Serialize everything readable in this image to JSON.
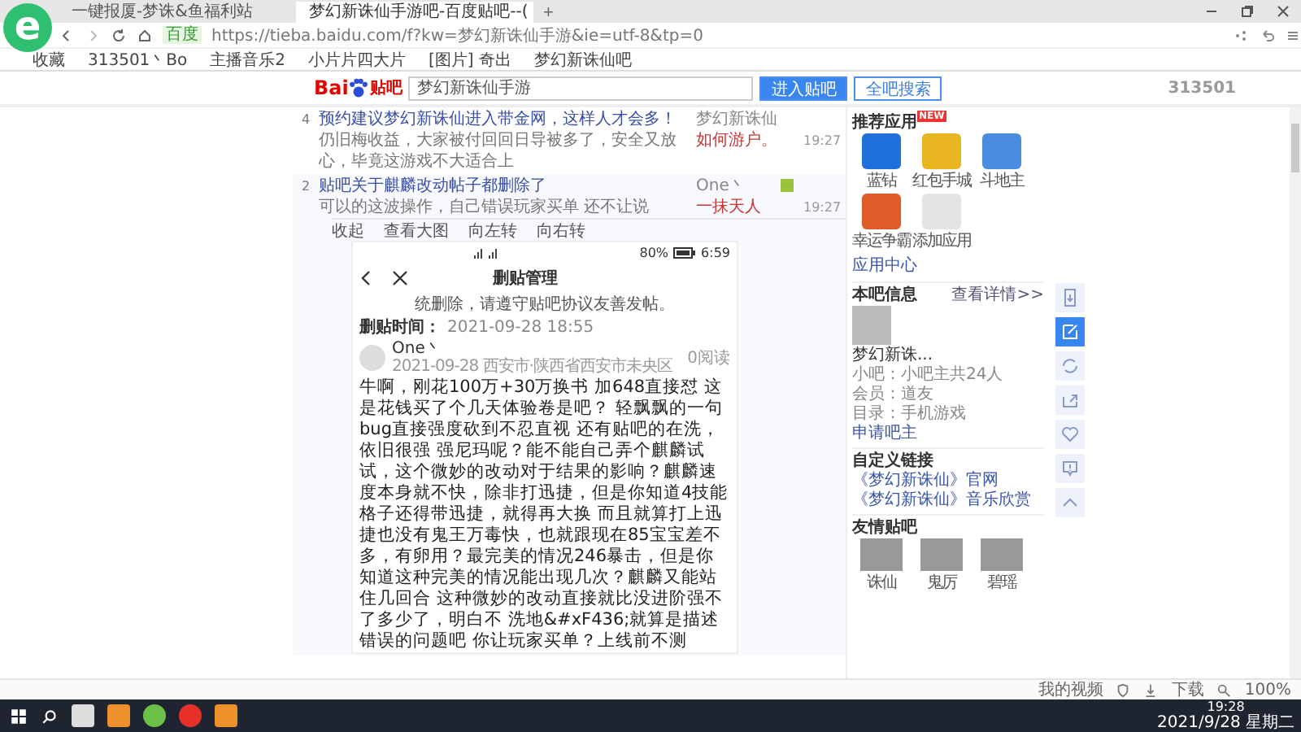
{
  "browser": {
    "logo": "e",
    "tabs": [
      {
        "title": "一键报厦-梦诛&鱼福利站",
        "selected": false
      },
      {
        "title": "梦幻新诛仙手游吧-百度贴吧--(",
        "selected": true
      }
    ],
    "add_tab": "+",
    "url_badge": "百度",
    "url": "https://tieba.baidu.com/f?kw=梦幻新诛仙手游&ie=utf-8&tp=0",
    "bookmarks": [
      "收藏",
      "313501丶Bo",
      "主播音乐2",
      "小片片四大片",
      "[图片] 奇出",
      "梦幻新诛仙吧"
    ]
  },
  "header": {
    "logo_latin": "Bai",
    "logo_cjk": "贴吧",
    "search_value": "梦幻新诛仙手游",
    "buttons": [
      "进入贴吧",
      "全吧搜索"
    ],
    "counter": "313501"
  },
  "threads": [
    {
      "reply_count": "4",
      "title": "预约建议梦幻新诛仙进入带金网，这样人才会多！",
      "excerpt": "仍旧梅收益，大家被付回回日导被多了，安全又放心，毕竟这游戏不大适合上",
      "author": "梦幻新诛仙",
      "last_reply": "如何游户。",
      "time": "19:27",
      "has_image": false
    },
    {
      "reply_count": "2",
      "title": "贴吧关于麒麟改动帖子都删除了",
      "excerpt": "可以的这波操作，自己错误玩家买单 还不让说",
      "author": "One丶",
      "last_reply": "一抹天人",
      "time": "19:27",
      "has_image": true,
      "toolbar": [
        "收起",
        "查看大图",
        "向左转",
        "向右转"
      ],
      "screenshot": {
        "battery": "80%",
        "clock": "6:59",
        "title": "删贴管理",
        "notice": "统删除，请遵守贴吧协议友善发帖。",
        "time_label": "删贴时间：",
        "time": "2021-09-28 18:55",
        "user": "One丶",
        "meta": "2021-09-28 西安市·陕西省西安市未央区",
        "reads": "0阅读",
        "body": "牛啊，刚花100万+30万换书 加648直接怼 这是花钱买了个几天体验卷是吧？ 轻飘飘的一句bug直接强度砍到不忍直视 还有贴吧的在洗，依旧很强 强尼玛呢？能不能自己弄个麒麟试试，这个微妙的改动对于结果的影响？麒麟速度本身就不快，除非打迅捷，但是你知道4技能格子还得带迅捷，就得再大换 而且就算打上迅捷也没有鬼王万毒快，也就跟现在85宝宝差不多，有卵用？最完美的情况246暴击，但是你知道这种完美的情况能出现几次？麒麟又能站住几回合 这种微妙的改动直接就比没进阶强不了多少了，明白不 洗地&#xF436;就算是描述错误的问题吧 你让玩家买单？上线前不测"
      }
    }
  ],
  "sidebar": {
    "apps_title": "推荐应用",
    "new_badge": "NEW",
    "apps": [
      {
        "label": "蓝钻",
        "color": "#1e6fd9"
      },
      {
        "label": "红包手城",
        "color": "#e8b420"
      },
      {
        "label": "斗地主",
        "color": "#4a8de0"
      },
      {
        "label": "幸运争霸",
        "color": "#e05a2a"
      },
      {
        "label": "添加应用",
        "color": "#e4e4e4"
      }
    ],
    "app_center": "应用中心",
    "info_title": "本吧信息",
    "info_link": "查看详情>>",
    "bar_name": "梦幻新诛...",
    "info_lines": [
      "小吧：小吧主共24人",
      "会员：道友",
      "目录：手机游戏"
    ],
    "apply": "申请吧主",
    "links_title": "自定义链接",
    "links": [
      "《梦幻新诛仙》官网",
      "《梦幻新诛仙》音乐欣赏"
    ],
    "friends_title": "友情贴吧",
    "friends": [
      "诛仙",
      "鬼厉",
      "碧瑶"
    ]
  },
  "float_buttons": [
    {
      "kind": "download",
      "selected": false
    },
    {
      "kind": "edit",
      "selected": true
    },
    {
      "kind": "refresh",
      "selected": false
    },
    {
      "kind": "share",
      "selected": false
    },
    {
      "kind": "heart",
      "selected": false
    },
    {
      "kind": "report",
      "selected": false
    },
    {
      "kind": "top",
      "selected": false
    }
  ],
  "status_bar": {
    "video": "我的视频",
    "download": "下载",
    "zoom": "100%"
  },
  "taskbar": {
    "time": "19:28",
    "date": "2021/9/28 星期二"
  }
}
